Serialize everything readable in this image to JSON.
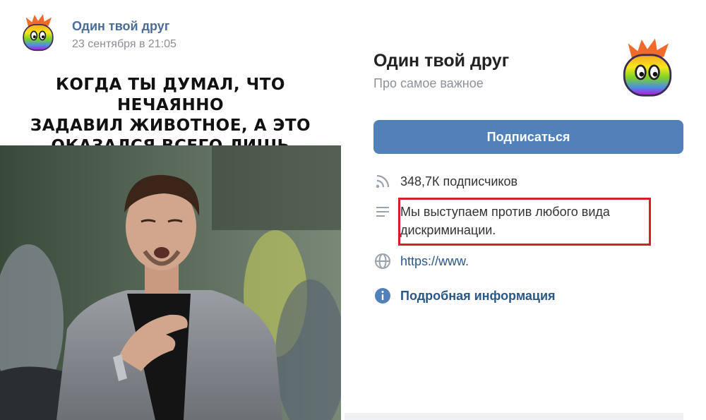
{
  "post": {
    "author": "Один твой друг",
    "date": "23 сентября в 21:05",
    "meme_caption_lines": [
      "КОГДА ТЫ ДУМАЛ, ЧТО НЕЧАЯННО",
      "ЗАДАВИЛ ЖИВОТНОЕ, А ЭТО",
      "ОКАЗАЛСЯ ВСЕГО ЛИШЬ ГОМОФОБ"
    ],
    "photo_icon": "relieved-man-photo"
  },
  "group": {
    "name": "Один твой друг",
    "status": "Про самое важное",
    "subscribe_label": "Подписаться",
    "subscribers": "348,7К подписчиков",
    "description": "Мы выступаем против любого вида дискриминации.",
    "link": "https://www.",
    "more_info": "Подробная информация",
    "avatar_icon": "rainbow-blob-mascot-icon"
  },
  "colors": {
    "accent": "#5181b8",
    "link": "#2a5885",
    "highlight": "#d4202a"
  }
}
